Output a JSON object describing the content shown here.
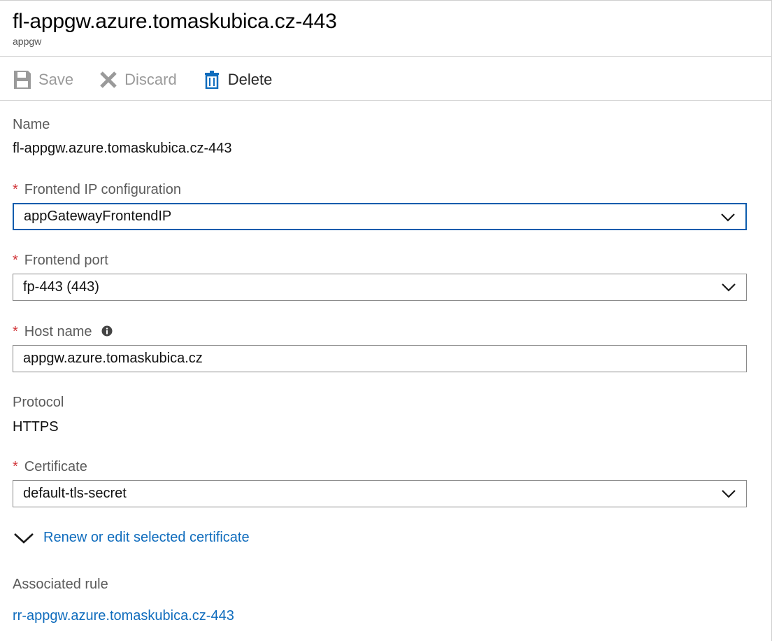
{
  "header": {
    "title": "fl-appgw.azure.tomaskubica.cz-443",
    "subtitle": "appgw"
  },
  "toolbar": {
    "save_label": "Save",
    "discard_label": "Discard",
    "delete_label": "Delete"
  },
  "form": {
    "name": {
      "label": "Name",
      "value": "fl-appgw.azure.tomaskubica.cz-443"
    },
    "frontend_ip": {
      "label": "Frontend IP configuration",
      "value": "appGatewayFrontendIP"
    },
    "frontend_port": {
      "label": "Frontend port",
      "value": "fp-443 (443)"
    },
    "host_name": {
      "label": "Host name",
      "value": "appgw.azure.tomaskubica.cz"
    },
    "protocol": {
      "label": "Protocol",
      "value": "HTTPS"
    },
    "certificate": {
      "label": "Certificate",
      "value": "default-tls-secret"
    },
    "renew_link": "Renew or edit selected certificate",
    "associated_rule": {
      "label": "Associated rule",
      "value": "rr-appgw.azure.tomaskubica.cz-443"
    },
    "required_mark": "*"
  },
  "colors": {
    "required": "#d13438",
    "link": "#0f6cbd",
    "focus_border": "#0b5cad",
    "delete_icon": "#0f6cbd"
  },
  "icons": {
    "save": "save-icon",
    "discard": "close-icon",
    "delete": "trash-icon",
    "info": "info-icon",
    "dropdown": "chevron-down-icon"
  }
}
